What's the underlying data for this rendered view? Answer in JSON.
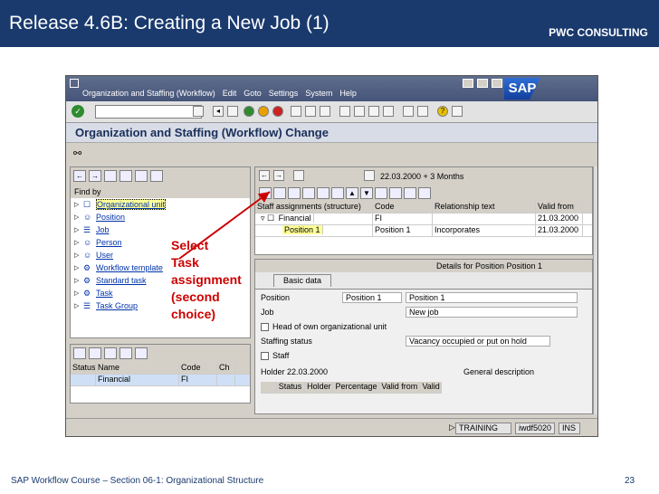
{
  "slide": {
    "title": "Release 4.6B: Creating a New Job  (1)",
    "brand": "PWC CONSULTING",
    "footer": "SAP Workflow Course – Section 06-1: Organizational Structure",
    "page_number": "23"
  },
  "sap": {
    "logo": "SAP",
    "menu": [
      "Organization and Staffing (Workflow)",
      "Edit",
      "Goto",
      "Settings",
      "System",
      "Help"
    ],
    "screen_title": "Organization and Staffing (Workflow) Change",
    "find_by_label": "Find by",
    "find_by_items": [
      {
        "label": "Organizational unit",
        "icon": "org-unit-icon",
        "selected": true
      },
      {
        "label": "Position",
        "icon": "position-icon"
      },
      {
        "label": "Job",
        "icon": "job-icon"
      },
      {
        "label": "Person",
        "icon": "person-icon"
      },
      {
        "label": "User",
        "icon": "user-icon"
      },
      {
        "label": "Workflow template",
        "icon": "workflow-icon"
      },
      {
        "label": "Standard task",
        "icon": "standard-task-icon"
      },
      {
        "label": "Task",
        "icon": "task-icon"
      },
      {
        "label": "Task Group",
        "icon": "task-group-icon"
      }
    ],
    "hit_list": {
      "headers": [
        "Status",
        "Name",
        "Code",
        "Ch"
      ],
      "rows": [
        {
          "name": "Financial",
          "code": "FI"
        }
      ]
    },
    "date_range": "22.03.2000  + 3 Months",
    "staff_table": {
      "headers": [
        "Staff assignments (structure)",
        "Code",
        "Relationship text",
        "Valid from"
      ],
      "rows": [
        {
          "name": "Financial",
          "code": "FI",
          "rel": "",
          "valid": "21.03.2000"
        },
        {
          "name": "Position 1",
          "code": "Position 1",
          "rel": "Incorporates",
          "valid": "21.03.2000"
        }
      ]
    },
    "details_title": "Details for Position Position 1",
    "tab_label": "Basic data",
    "form": {
      "position_label": "Position",
      "position_short": "Position 1",
      "position_long": "Position 1",
      "job_label": "Job",
      "job_value": "New job",
      "head_label": "Head of own organizational unit",
      "staffing_label": "Staffing status",
      "staffing_value": "Vacancy occupied or put on hold",
      "staff_label": "Staff",
      "holder_label": "Holder 22.03.2000",
      "general_desc": "General description",
      "holder_cols": [
        "Status",
        "Holder",
        "Percentage",
        "Valid from",
        "Valid"
      ]
    },
    "status": {
      "system": "TRAINING",
      "server": "iwdf5020",
      "mode": "INS"
    }
  },
  "callout": {
    "lines": [
      "Select",
      "Task",
      "assignment",
      "(second",
      "choice)"
    ],
    "color": "#cc0000"
  }
}
